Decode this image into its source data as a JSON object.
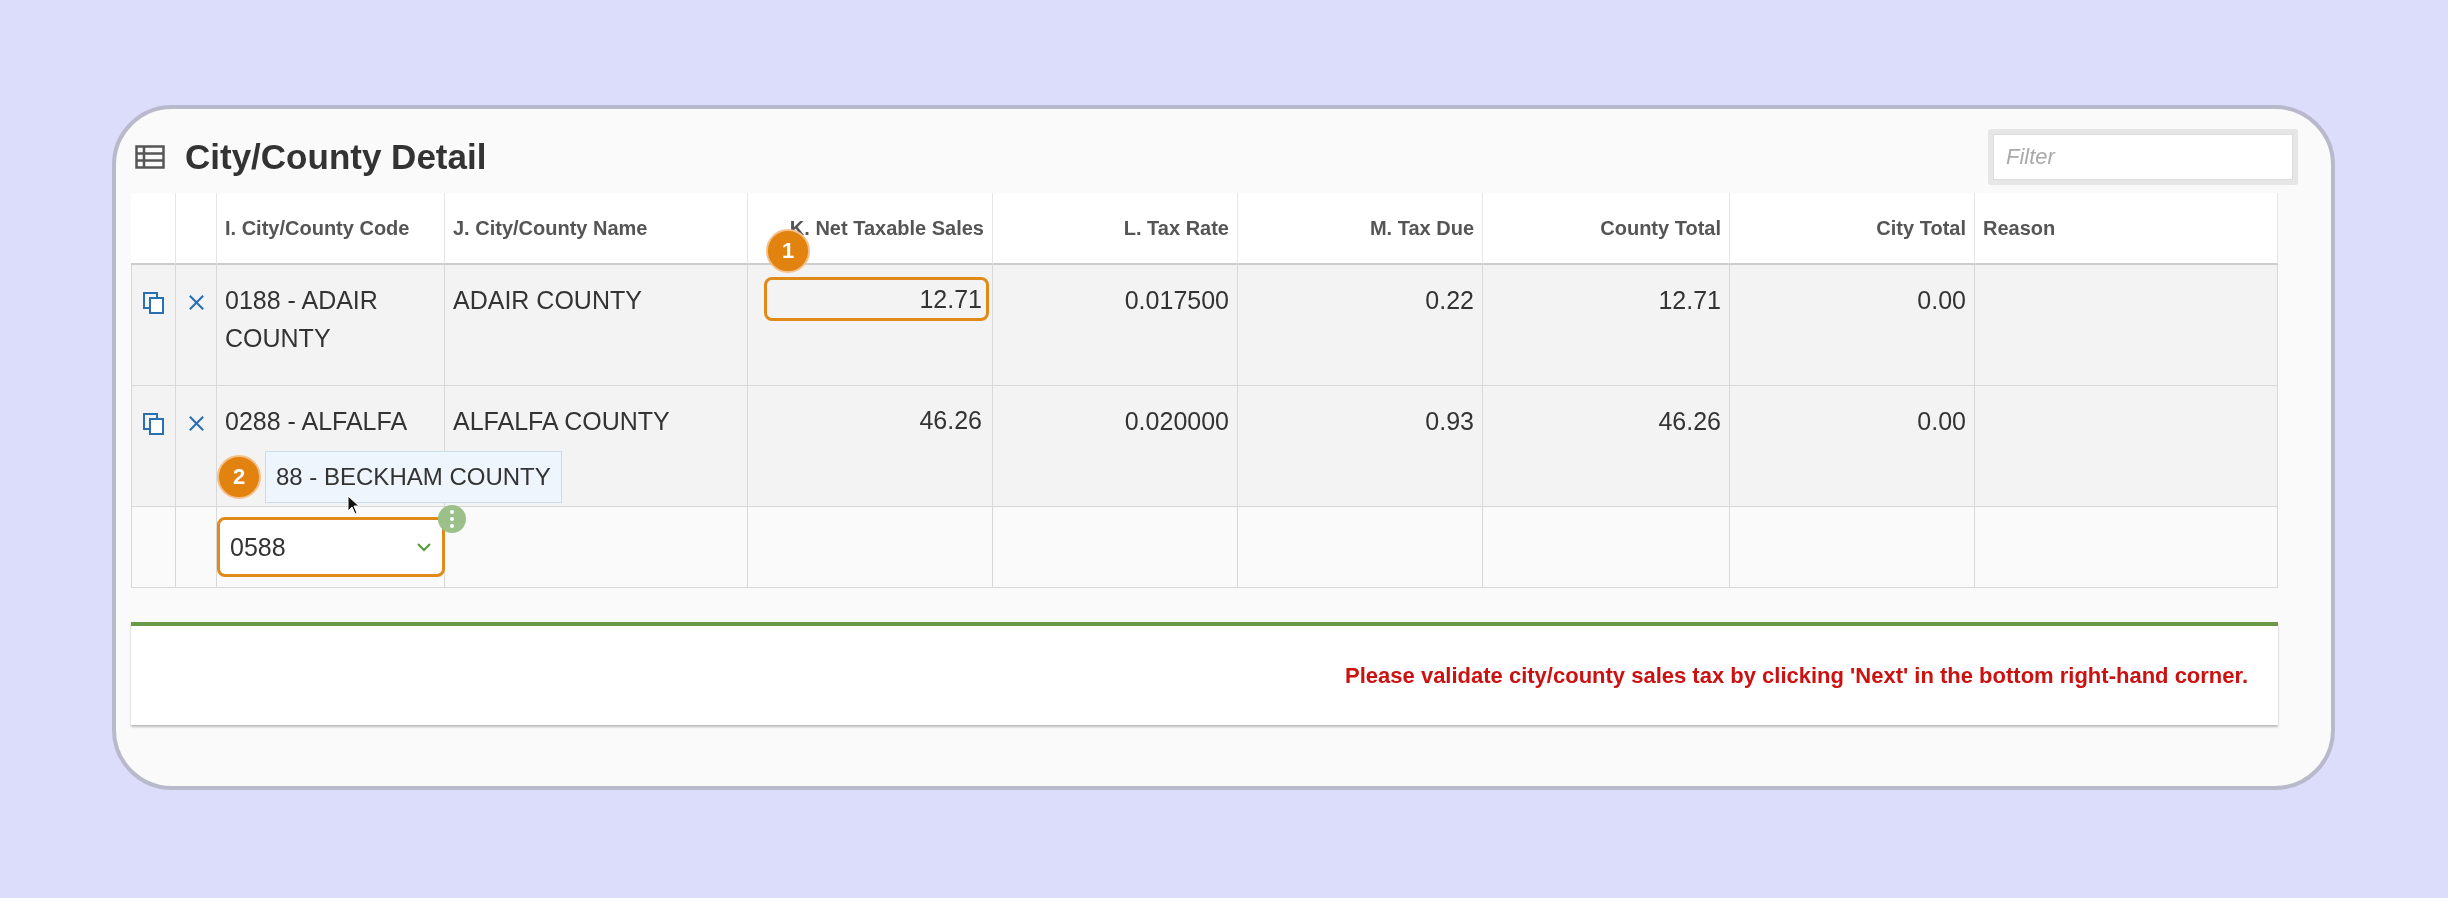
{
  "section": {
    "title": "City/County Detail",
    "filter": {
      "placeholder": "Filter"
    }
  },
  "table": {
    "columns": [
      "I. City/County Code",
      "J. City/County Name",
      "K. Net Taxable Sales",
      "L. Tax Rate",
      "M. Tax Due",
      "County Total",
      "City Total",
      "Reason"
    ],
    "rows": [
      {
        "cells": [
          "0188 - ADAIR COUNTY",
          "ADAIR COUNTY",
          "12.71",
          "0.017500",
          "0.22",
          "12.71",
          "0.00"
        ],
        "highlighted": true
      },
      {
        "cells": [
          "0288 - ALFALFA",
          "ALFALFA COUNTY",
          "46.26",
          "0.020000",
          "0.93",
          "46.26",
          "0.00"
        ],
        "highlighted": false
      }
    ]
  },
  "new_row": {
    "code_input": {
      "value": "0588"
    },
    "suggestion": "88 - BECKHAM COUNTY"
  },
  "callouts": [
    {
      "label": "1"
    },
    {
      "label": "2"
    }
  ],
  "message": "Please validate city/county sales tax by clicking 'Next' in the bottom right-hand corner."
}
